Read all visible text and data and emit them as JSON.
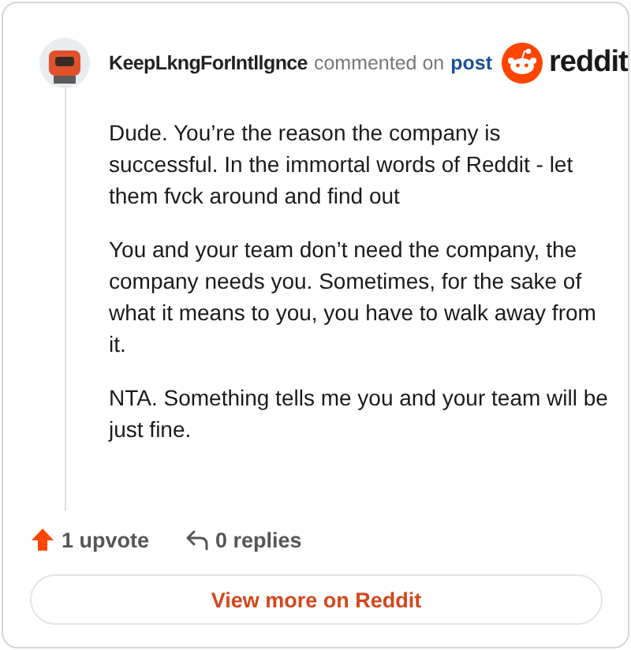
{
  "comment": {
    "author": "KeepLkngForIntllgnce",
    "action": "commented on",
    "link": "post",
    "brand": "reddit",
    "paragraphs": [
      "Dude. You’re the reason the company is successful. In the immortal words of Reddit - let them fvck around and find out",
      "You and your team don’t need the company, the company needs you. Sometimes, for the sake of what it means to you, you have to walk away from it.",
      "NTA. Something tells me you and your team will be just fine."
    ]
  },
  "actions": {
    "upvotes": "1 upvote",
    "replies": "0 replies"
  },
  "button": "View more on Reddit"
}
